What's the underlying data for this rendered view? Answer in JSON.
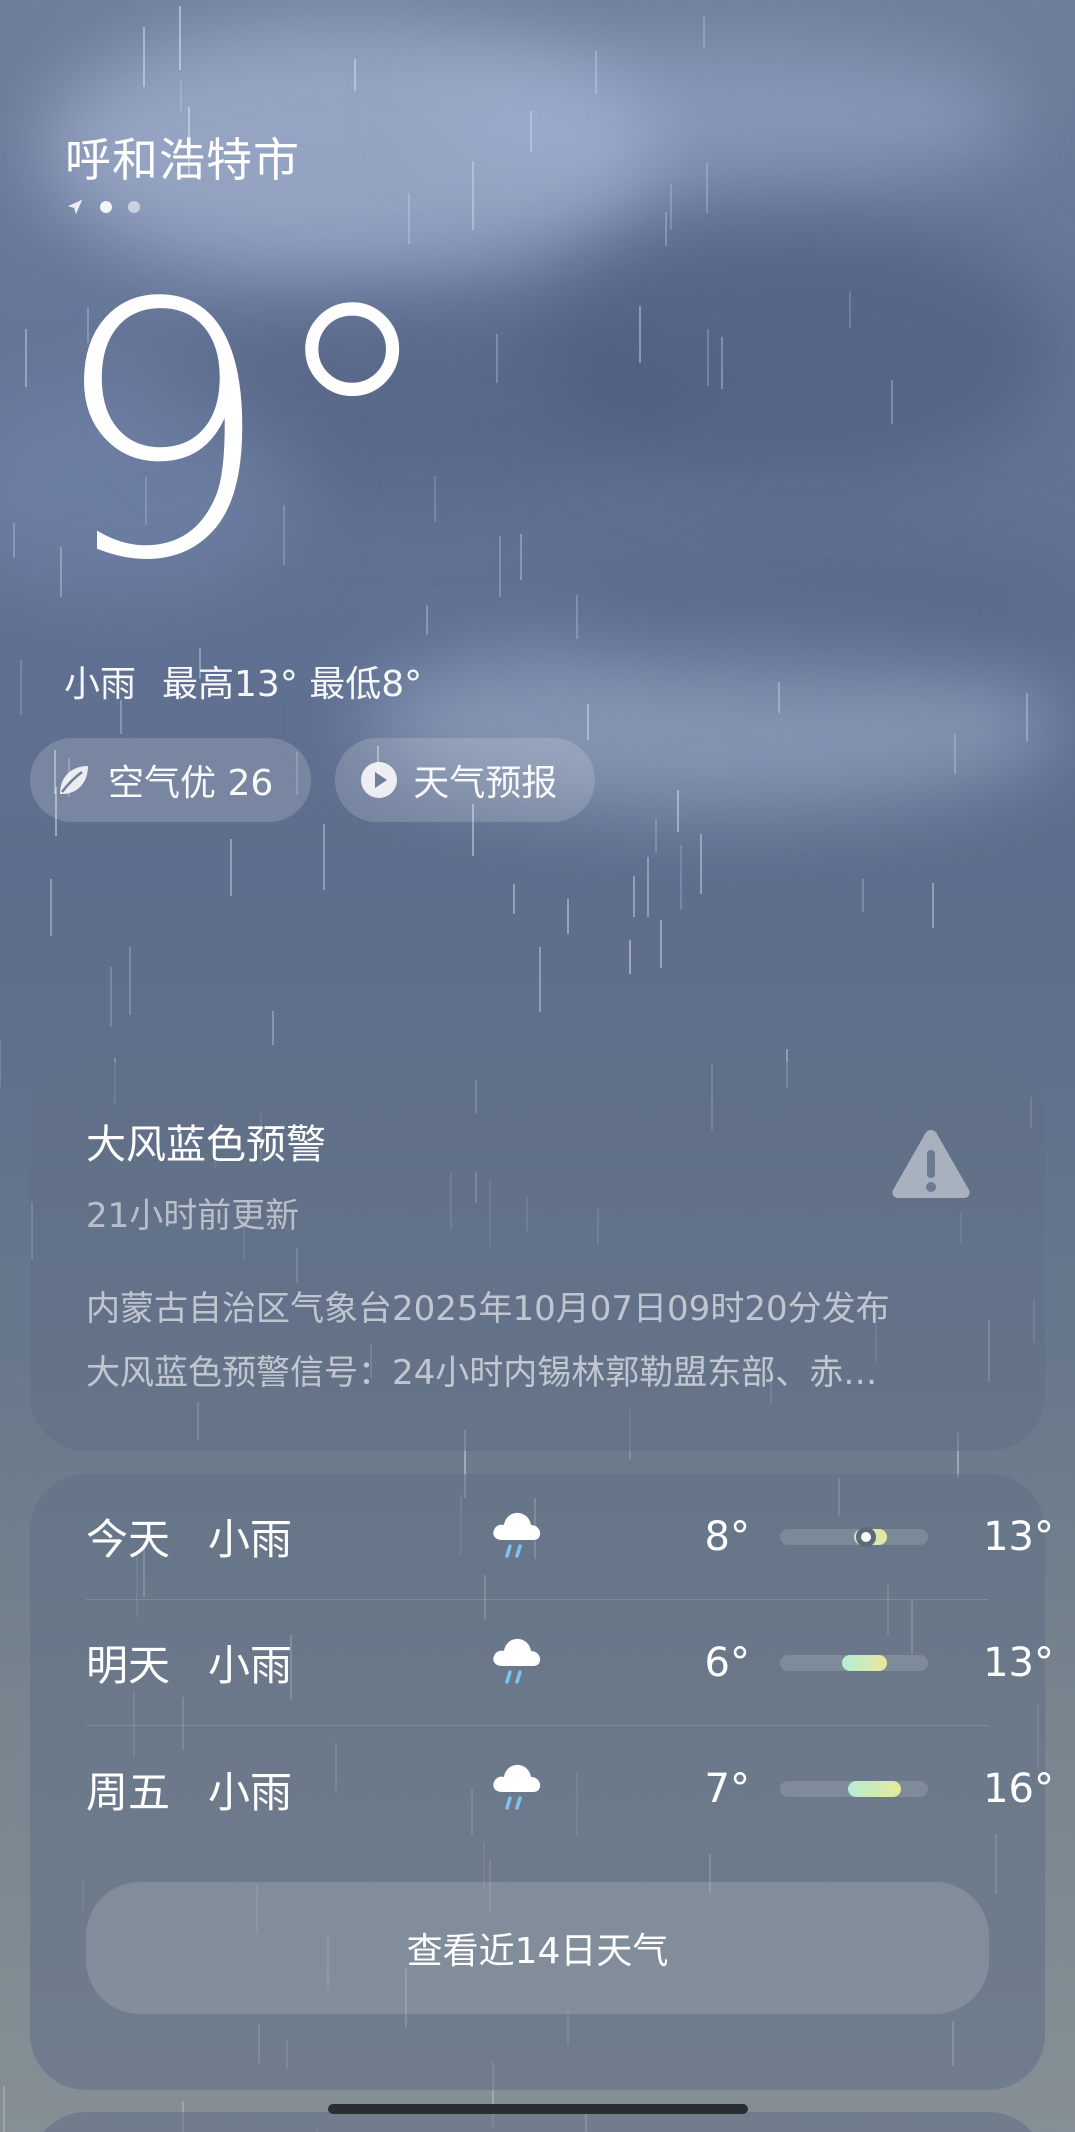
{
  "location": {
    "city": "呼和浩特市",
    "page_indicator_icon": "location-arrow-icon"
  },
  "current": {
    "temperature": "9°",
    "condition": "小雨",
    "high": "最高13°",
    "low": "最低8°"
  },
  "pills": {
    "air_quality": {
      "icon": "leaf-icon",
      "label": "空气优 26"
    },
    "forecast_video": {
      "icon": "play-circle-icon",
      "label": "天气预报"
    }
  },
  "alert": {
    "title": "大风蓝色预警",
    "updated": "21小时前更新",
    "body_line1": "内蒙古自治区气象台2025年10月07日09时20分发布",
    "body_line2": "大风蓝色预警信号：24小时内锡林郭勒盟东部、赤…",
    "icon": "warning-triangle-icon"
  },
  "forecast": {
    "days": [
      {
        "day": "今天",
        "condition": "小雨",
        "icon": "cloud-rain-icon",
        "low": "8°",
        "high": "13°",
        "bar_start": 0.5,
        "bar_end": 0.72,
        "current_marker": 0.58
      },
      {
        "day": "明天",
        "condition": "小雨",
        "icon": "cloud-rain-icon",
        "low": "6°",
        "high": "13°",
        "bar_start": 0.42,
        "bar_end": 0.72
      },
      {
        "day": "周五",
        "condition": "小雨",
        "icon": "cloud-rain-icon",
        "low": "7°",
        "high": "16°",
        "bar_start": 0.46,
        "bar_end": 0.82
      }
    ],
    "more_button": "查看近14日天气"
  },
  "colors": {
    "range_bar_start": "#b7ecd6",
    "range_bar_end": "#e6e99a"
  }
}
